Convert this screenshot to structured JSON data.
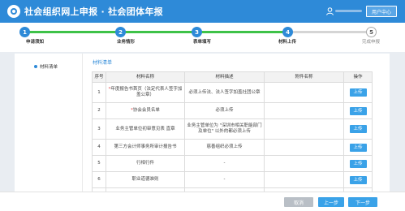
{
  "header": {
    "title": "社会组织网上申报 · 社会团体年报",
    "user_center_label": "用户中心"
  },
  "steps": [
    {
      "num": "1",
      "label": "申请须知"
    },
    {
      "num": "2",
      "label": "业务情形"
    },
    {
      "num": "3",
      "label": "表单填写"
    },
    {
      "num": "4",
      "label": "材料上传"
    },
    {
      "num": "5",
      "label": "完成申报"
    }
  ],
  "sidebar": {
    "items": [
      {
        "label": "材料清单"
      }
    ]
  },
  "main": {
    "section_title": "材料清单",
    "table": {
      "headers": [
        "序号",
        "材料名称",
        "材料描述",
        "附件名称",
        "操作"
      ],
      "rows": [
        {
          "no": "1",
          "required": "*",
          "name": "年度报告书首页（法定代表人签字加盖公章）",
          "desc": "必须上传法、法人签字加盖社团公章",
          "attachment": "",
          "action": "上传"
        },
        {
          "no": "2",
          "required": "*",
          "name": "协会会员名单",
          "desc": "必须上传",
          "attachment": "",
          "action": "上传"
        },
        {
          "no": "3",
          "required": "",
          "name": "业务主管单位初审意见表 直章",
          "desc": "业务主管单位为 \"深圳市相关职能部门及单位\" 以外的都必须上传",
          "attachment": "",
          "action": "上传"
        },
        {
          "no": "4",
          "required": "",
          "name": "第三方会计师事务所审计报告书",
          "desc": "慈善组织必须上传",
          "attachment": "",
          "action": "上传"
        },
        {
          "no": "5",
          "required": "",
          "name": "行相行件",
          "desc": "-",
          "attachment": "",
          "action": "上传"
        },
        {
          "no": "6",
          "required": "",
          "name": "职业道德准则",
          "desc": "-",
          "attachment": "",
          "action": "上传"
        }
      ]
    }
  },
  "footer": {
    "cancel_label": "取消",
    "prev_label": "上一步",
    "next_label": "下一步"
  },
  "colors": {
    "primary": "#2e8ad8",
    "progress": "#3ec248",
    "button": "#3aa2e8",
    "required": "#e03a3a"
  }
}
